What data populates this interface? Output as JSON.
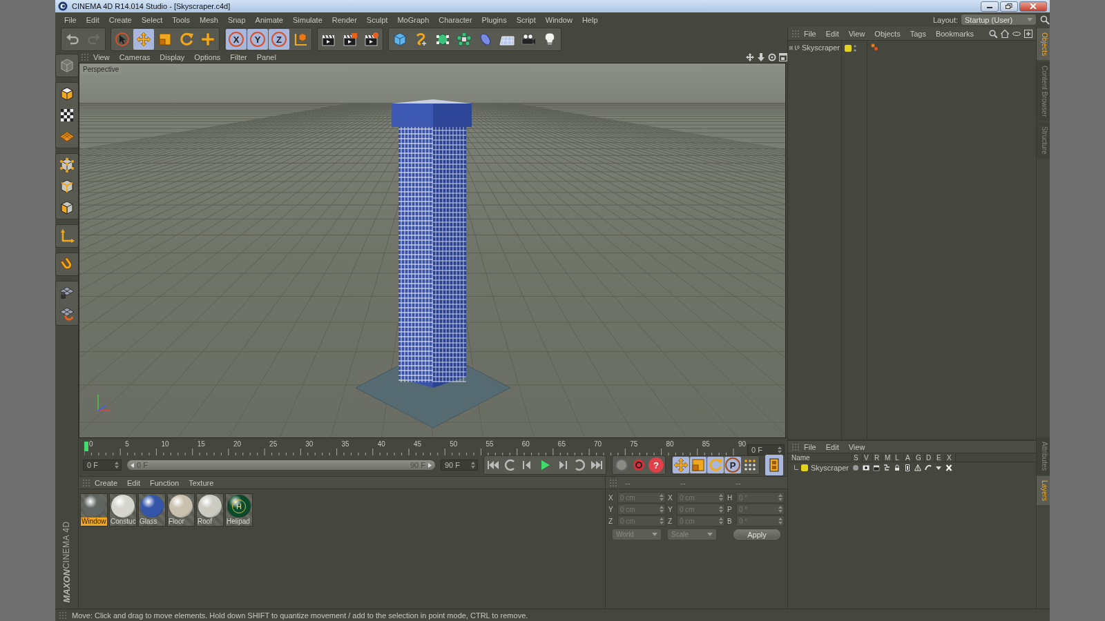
{
  "window": {
    "title": "CINEMA 4D R14.014 Studio - [Skyscraper.c4d]"
  },
  "menu_bar": [
    "File",
    "Edit",
    "Create",
    "Select",
    "Tools",
    "Mesh",
    "Snap",
    "Animate",
    "Simulate",
    "Render",
    "Sculpt",
    "MoGraph",
    "Character",
    "Plugins",
    "Script",
    "Window",
    "Help"
  ],
  "layout": {
    "label": "Layout:",
    "value": "Startup (User)"
  },
  "toolbar": [
    [
      {
        "kind": "undo",
        "selected": false
      },
      {
        "kind": "redo",
        "selected": false
      }
    ],
    [
      {
        "kind": "select",
        "selected": false
      },
      {
        "kind": "move",
        "selected": true
      },
      {
        "kind": "scale",
        "selected": false
      },
      {
        "kind": "rotate",
        "selected": false
      },
      {
        "kind": "add",
        "selected": false
      }
    ],
    [
      {
        "kind": "axis",
        "label": "X",
        "selected": true
      },
      {
        "kind": "axis",
        "label": "Y",
        "selected": true
      },
      {
        "kind": "axis",
        "label": "Z",
        "selected": true
      },
      {
        "kind": "coord",
        "selected": false
      }
    ],
    [
      {
        "kind": "render_view",
        "selected": false
      },
      {
        "kind": "render_picture",
        "selected": false
      },
      {
        "kind": "render_settings",
        "selected": false
      }
    ],
    [
      {
        "kind": "cube",
        "selected": false
      },
      {
        "kind": "spline",
        "selected": false
      },
      {
        "kind": "nurbs",
        "selected": false
      },
      {
        "kind": "array",
        "selected": false
      },
      {
        "kind": "deformer",
        "selected": false
      },
      {
        "kind": "floor",
        "selected": false
      },
      {
        "kind": "camera",
        "selected": false
      },
      {
        "kind": "light",
        "selected": false
      }
    ]
  ],
  "tool_palette": [
    [
      {
        "kind": "model"
      }
    ],
    [
      {
        "kind": "object"
      },
      {
        "kind": "texture"
      },
      {
        "kind": "workplane"
      }
    ],
    [
      {
        "kind": "points"
      },
      {
        "kind": "edges"
      },
      {
        "kind": "polygons"
      }
    ],
    [
      {
        "kind": "axis_tool"
      }
    ],
    [
      {
        "kind": "magnet"
      }
    ],
    [
      {
        "kind": "gridlock"
      },
      {
        "kind": "snap"
      }
    ]
  ],
  "viewport": {
    "menu": [
      "View",
      "Cameras",
      "Display",
      "Options",
      "Filter",
      "Panel"
    ],
    "camera": "Perspective"
  },
  "timeline": {
    "ticks": [
      "0",
      "5",
      "10",
      "15",
      "20",
      "25",
      "30",
      "35",
      "40",
      "45",
      "50",
      "55",
      "60",
      "65",
      "70",
      "75",
      "80",
      "85",
      "90"
    ],
    "current_frame": "0 F",
    "playhead": {
      "level": 0
    },
    "start_frame": "0 F",
    "range": {
      "level": 1
    },
    "range_start": "0 F",
    "range_end": "90 F",
    "end_frame": "90 F",
    "transport": [
      {
        "kind": "first"
      },
      {
        "kind": "loop_back"
      },
      {
        "kind": "prev"
      },
      {
        "kind": "play"
      },
      {
        "kind": "next"
      },
      {
        "kind": "loop_forward"
      },
      {
        "kind": "last"
      }
    ],
    "keys": [
      {
        "kind": "record_off"
      },
      {
        "kind": "record"
      },
      {
        "kind": "help",
        "label": "?"
      }
    ],
    "modes": [
      {
        "kind": "move",
        "selected": true
      },
      {
        "kind": "scale",
        "selected": true
      },
      {
        "kind": "rotate",
        "selected": true
      },
      {
        "kind": "param",
        "label": "P",
        "selected": true
      },
      {
        "kind": "dots",
        "selected": false
      }
    ],
    "film": {
      "selected": true
    }
  },
  "materials": {
    "menu": [
      "Create",
      "Edit",
      "Function",
      "Texture"
    ],
    "items": [
      {
        "name": "Window",
        "color": "#5f6560",
        "selected": true
      },
      {
        "name": "Constuc",
        "color": "#d6d6ce",
        "selected": false
      },
      {
        "name": "Glass",
        "color": "#3556a8",
        "selected": false
      },
      {
        "name": "Floor",
        "color": "#c9c0ae",
        "selected": false
      },
      {
        "name": "Roof",
        "color": "#cbcbc2",
        "selected": false
      },
      {
        "name": "Helipad",
        "color": "#0c4a2c",
        "emblem": "H",
        "selected": false
      }
    ]
  },
  "coordinates": {
    "headers": [
      "--",
      "--",
      "--"
    ],
    "rows": [
      {
        "pos_label": "X",
        "pos": "0 cm",
        "size_label": "X",
        "size": "0 cm",
        "rot_label": "H",
        "rot": "0 °"
      },
      {
        "pos_label": "Y",
        "pos": "0 cm",
        "size_label": "Y",
        "size": "0 cm",
        "rot_label": "P",
        "rot": "0 °"
      },
      {
        "pos_label": "Z",
        "pos": "0 cm",
        "size_label": "Z",
        "size": "0 cm",
        "rot_label": "B",
        "rot": "0 °"
      }
    ],
    "space": "World",
    "mode": "Scale",
    "apply": "Apply"
  },
  "objects": {
    "menu": [
      "File",
      "Edit",
      "View",
      "Objects",
      "Tags",
      "Bookmarks"
    ],
    "items": [
      {
        "name": "Skyscraper",
        "color": "#e2d21e",
        "expanded": false
      }
    ]
  },
  "layers": {
    "menu": [
      "File",
      "Edit",
      "View"
    ],
    "columns": [
      "Name",
      "S",
      "V",
      "R",
      "M",
      "L",
      "A",
      "G",
      "D",
      "E",
      "X"
    ],
    "rows": [
      {
        "name": "Skyscraper",
        "color": "#e2d21e"
      }
    ]
  },
  "side_tabs": {
    "top": [
      {
        "label": "Objects",
        "selected": true
      },
      {
        "label": "Content Browser",
        "selected": false
      },
      {
        "label": "Structure",
        "selected": false
      }
    ],
    "bottom": [
      {
        "label": "Attributes",
        "selected": false
      },
      {
        "label": "Layers",
        "selected": true
      }
    ]
  },
  "logo": {
    "brand": "MAXON",
    "product": "CINEMA 4D"
  },
  "status_bar": "Move: Click and drag to move elements. Hold down SHIFT to quantize movement / add to the selection in point mode, CTRL to remove."
}
